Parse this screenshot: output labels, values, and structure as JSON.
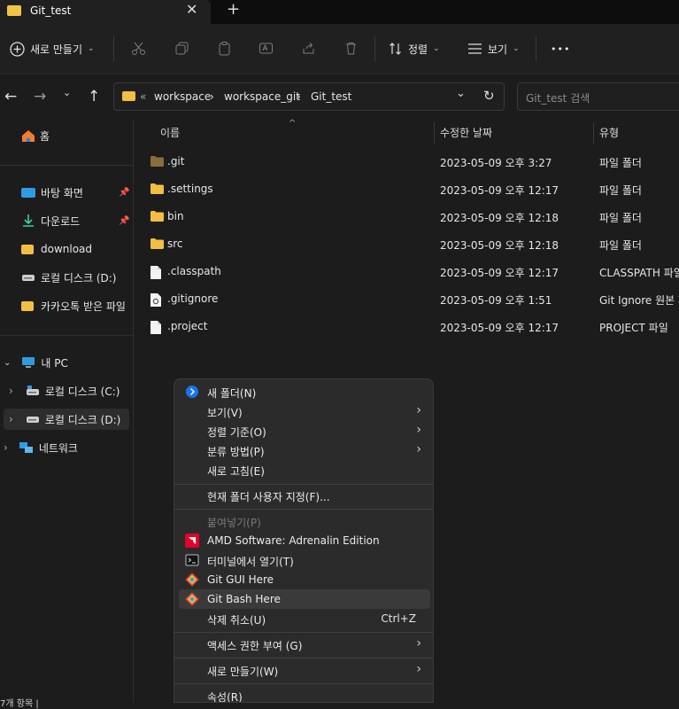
{
  "tab": {
    "title": "Git_test",
    "close": "✕",
    "new": "+"
  },
  "commandbar": {
    "new_label": "새로 만들기",
    "sort_label": "정렬",
    "view_label": "보기",
    "more": "•••"
  },
  "nav": {
    "back": "←",
    "forward": "→",
    "expand": "⌄",
    "up": "↑",
    "crumb_prefix": "«",
    "crumbs": [
      "workspace",
      "workspace_git",
      "Git_test"
    ],
    "crumb_sep": "›",
    "dropdown": "⌄",
    "refresh": "↻",
    "search_placeholder": "Git_test 검색"
  },
  "sidebar": {
    "home": "홈",
    "quick": [
      {
        "label": "바탕 화면",
        "pinned": true
      },
      {
        "label": "다운로드",
        "pinned": true
      },
      {
        "label": "download"
      },
      {
        "label": "로컬 디스크 (D:)"
      },
      {
        "label": "카카오톡 받은 파일"
      }
    ],
    "pc": "내 PC",
    "drives": [
      "로컬 디스크 (C:)",
      "로컬 디스크 (D:)"
    ],
    "network": "네트워크",
    "status_partial": "7개 항목  |"
  },
  "columns": {
    "name": "이름",
    "modified": "수정한 날짜",
    "type": "유형"
  },
  "files": [
    {
      "name": ".git",
      "modified": "2023-05-09 오후 3:27",
      "type": "파일 폴더",
      "icon": "folder-dark"
    },
    {
      "name": ".settings",
      "modified": "2023-05-09 오후 12:17",
      "type": "파일 폴더",
      "icon": "folder"
    },
    {
      "name": "bin",
      "modified": "2023-05-09 오후 12:18",
      "type": "파일 폴더",
      "icon": "folder"
    },
    {
      "name": "src",
      "modified": "2023-05-09 오후 12:18",
      "type": "파일 폴더",
      "icon": "folder"
    },
    {
      "name": ".classpath",
      "modified": "2023-05-09 오후 12:17",
      "type": "CLASSPATH 파일",
      "icon": "file"
    },
    {
      "name": ".gitignore",
      "modified": "2023-05-09 오후 1:51",
      "type": "Git Ignore 원본 파일",
      "icon": "file-gear"
    },
    {
      "name": ".project",
      "modified": "2023-05-09 오후 12:17",
      "type": "PROJECT 파일",
      "icon": "file"
    }
  ],
  "menu": {
    "new_folder": "새 폴더(N)",
    "view": "보기(V)",
    "sort": "정렬 기준(O)",
    "group": "분류 방법(P)",
    "refresh": "새로 고침(E)",
    "customize": "현재 폴더 사용자 지정(F)...",
    "paste": "붙여넣기(P)",
    "amd": "AMD Software: Adrenalin Edition",
    "terminal": "터미널에서 열기(T)",
    "git_gui": "Git GUI Here",
    "git_bash": "Git Bash Here",
    "undo": "삭제 취소(U)",
    "undo_shortcut": "Ctrl+Z",
    "access": "액세스 권한 부여 (G)",
    "new": "새로 만들기(W)",
    "properties": "속성(R)",
    "arrow": "›"
  },
  "colors": {
    "folder": "#f3bf42",
    "accent": "#0078d4",
    "amd_red": "#e4002b",
    "git_orange": "#f05133"
  }
}
